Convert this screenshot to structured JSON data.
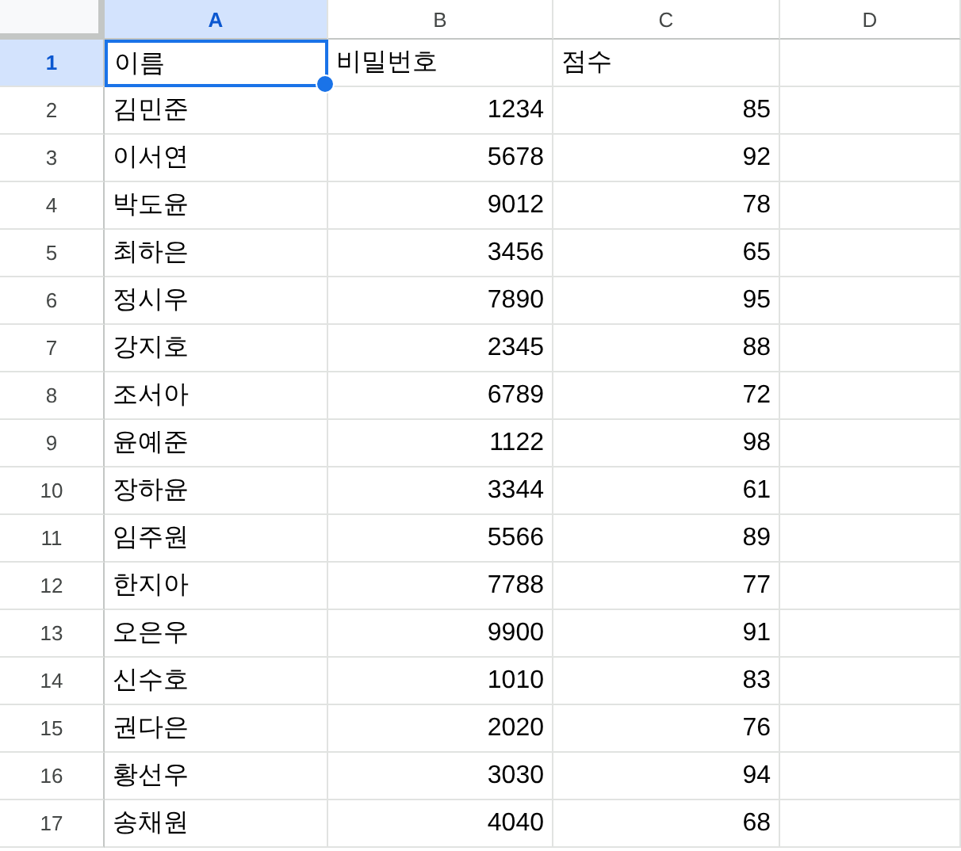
{
  "columns": [
    {
      "label": "A",
      "selected": true
    },
    {
      "label": "B",
      "selected": false
    },
    {
      "label": "C",
      "selected": false
    },
    {
      "label": "D",
      "selected": false
    }
  ],
  "rows": [
    {
      "number": "1",
      "selected": true,
      "cells": [
        {
          "text": "이름",
          "kind": "text"
        },
        {
          "text": "비밀번호",
          "kind": "text"
        },
        {
          "text": "점수",
          "kind": "text"
        }
      ]
    },
    {
      "number": "2",
      "selected": false,
      "cells": [
        {
          "text": "김민준",
          "kind": "text"
        },
        {
          "text": "1234",
          "kind": "number"
        },
        {
          "text": "85",
          "kind": "number"
        }
      ]
    },
    {
      "number": "3",
      "selected": false,
      "cells": [
        {
          "text": "이서연",
          "kind": "text"
        },
        {
          "text": "5678",
          "kind": "number"
        },
        {
          "text": "92",
          "kind": "number"
        }
      ]
    },
    {
      "number": "4",
      "selected": false,
      "cells": [
        {
          "text": "박도윤",
          "kind": "text"
        },
        {
          "text": "9012",
          "kind": "number"
        },
        {
          "text": "78",
          "kind": "number"
        }
      ]
    },
    {
      "number": "5",
      "selected": false,
      "cells": [
        {
          "text": "최하은",
          "kind": "text"
        },
        {
          "text": "3456",
          "kind": "number"
        },
        {
          "text": "65",
          "kind": "number"
        }
      ]
    },
    {
      "number": "6",
      "selected": false,
      "cells": [
        {
          "text": "정시우",
          "kind": "text"
        },
        {
          "text": "7890",
          "kind": "number"
        },
        {
          "text": "95",
          "kind": "number"
        }
      ]
    },
    {
      "number": "7",
      "selected": false,
      "cells": [
        {
          "text": "강지호",
          "kind": "text"
        },
        {
          "text": "2345",
          "kind": "number"
        },
        {
          "text": "88",
          "kind": "number"
        }
      ]
    },
    {
      "number": "8",
      "selected": false,
      "cells": [
        {
          "text": "조서아",
          "kind": "text"
        },
        {
          "text": "6789",
          "kind": "number"
        },
        {
          "text": "72",
          "kind": "number"
        }
      ]
    },
    {
      "number": "9",
      "selected": false,
      "cells": [
        {
          "text": "윤예준",
          "kind": "text"
        },
        {
          "text": "1122",
          "kind": "number"
        },
        {
          "text": "98",
          "kind": "number"
        }
      ]
    },
    {
      "number": "10",
      "selected": false,
      "cells": [
        {
          "text": "장하윤",
          "kind": "text"
        },
        {
          "text": "3344",
          "kind": "number"
        },
        {
          "text": "61",
          "kind": "number"
        }
      ]
    },
    {
      "number": "11",
      "selected": false,
      "cells": [
        {
          "text": "임주원",
          "kind": "text"
        },
        {
          "text": "5566",
          "kind": "number"
        },
        {
          "text": "89",
          "kind": "number"
        }
      ]
    },
    {
      "number": "12",
      "selected": false,
      "cells": [
        {
          "text": "한지아",
          "kind": "text"
        },
        {
          "text": "7788",
          "kind": "number"
        },
        {
          "text": "77",
          "kind": "number"
        }
      ]
    },
    {
      "number": "13",
      "selected": false,
      "cells": [
        {
          "text": "오은우",
          "kind": "text"
        },
        {
          "text": "9900",
          "kind": "number"
        },
        {
          "text": "91",
          "kind": "number"
        }
      ]
    },
    {
      "number": "14",
      "selected": false,
      "cells": [
        {
          "text": "신수호",
          "kind": "text"
        },
        {
          "text": "1010",
          "kind": "number"
        },
        {
          "text": "83",
          "kind": "number"
        }
      ]
    },
    {
      "number": "15",
      "selected": false,
      "cells": [
        {
          "text": "권다은",
          "kind": "text"
        },
        {
          "text": "2020",
          "kind": "number"
        },
        {
          "text": "76",
          "kind": "number"
        }
      ]
    },
    {
      "number": "16",
      "selected": false,
      "cells": [
        {
          "text": "황선우",
          "kind": "text"
        },
        {
          "text": "3030",
          "kind": "number"
        },
        {
          "text": "94",
          "kind": "number"
        }
      ]
    },
    {
      "number": "17",
      "selected": false,
      "cells": [
        {
          "text": "송채원",
          "kind": "text"
        },
        {
          "text": "4040",
          "kind": "number"
        },
        {
          "text": "68",
          "kind": "number"
        }
      ]
    }
  ]
}
